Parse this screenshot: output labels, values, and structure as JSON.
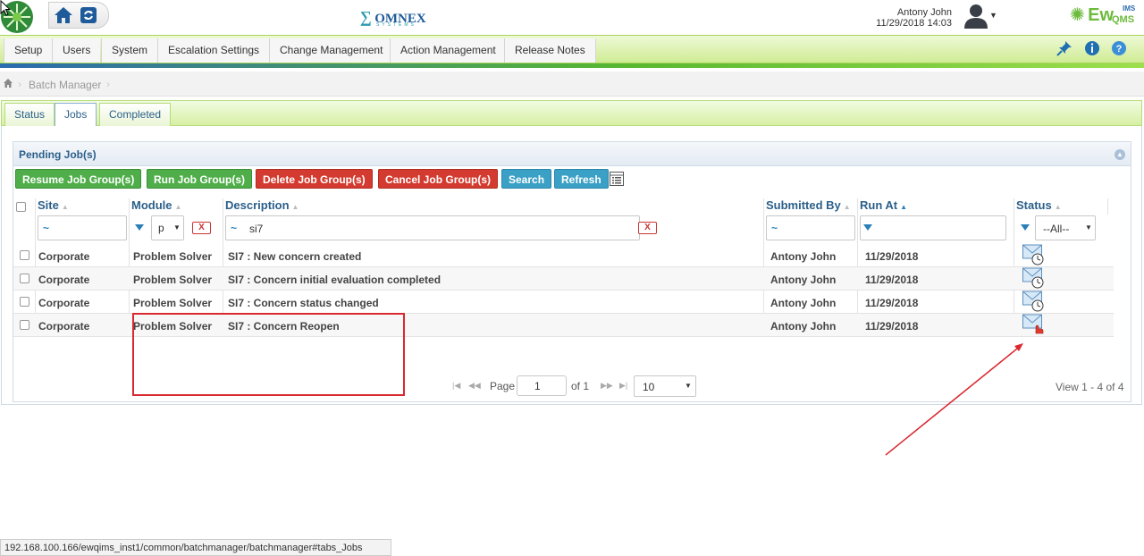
{
  "header": {
    "brand_center": "OMNEX",
    "brand_center_sub": "SYSTEMS",
    "user_name": "Antony John",
    "datetime": "11/29/2018 14:03",
    "brand_right": "Ew",
    "brand_right_sub": "QMS",
    "brand_right_ims": "IMS",
    "brand_color": "#2b6cb0",
    "accent_green": "#58b830"
  },
  "menu": {
    "items": [
      "Setup",
      "Users",
      "System",
      "Escalation Settings",
      "Change Management",
      "Action Management",
      "Release Notes"
    ],
    "icons": [
      "pin-icon",
      "info-icon",
      "help-icon"
    ]
  },
  "breadcrumb": {
    "current": "Batch Manager"
  },
  "tabs": {
    "items": [
      "Status",
      "Jobs",
      "Completed"
    ],
    "active": "Jobs"
  },
  "grid": {
    "title": "Pending Job(s)",
    "buttons": {
      "resume": "Resume Job Group(s)",
      "run": "Run Job Group(s)",
      "delete": "Delete Job Group(s)",
      "cancel": "Cancel Job Group(s)",
      "search": "Search",
      "refresh": "Refresh"
    },
    "columns": {
      "site": "Site",
      "module": "Module",
      "description": "Description",
      "submitted_by": "Submitted By",
      "run_at": "Run At",
      "status": "Status"
    },
    "filters": {
      "site": "~",
      "module": "p",
      "description_tilde": "~",
      "description": "si7",
      "submitted_by": "~",
      "status": "--All--",
      "clear": "X"
    },
    "rows": [
      {
        "site": "Corporate",
        "module": "Problem Solver",
        "description": "SI7 :  New concern created",
        "submitted_by": "Antony John",
        "run_at": "11/29/2018"
      },
      {
        "site": "Corporate",
        "module": "Problem Solver",
        "description": "SI7 :  Concern initial evaluation completed",
        "submitted_by": "Antony John",
        "run_at": "11/29/2018"
      },
      {
        "site": "Corporate",
        "module": "Problem Solver",
        "description": "SI7 :  Concern status changed",
        "submitted_by": "Antony John",
        "run_at": "11/29/2018"
      },
      {
        "site": "Corporate",
        "module": "Problem Solver",
        "description": "SI7 :  Concern Reopen",
        "submitted_by": "Antony John",
        "run_at": "11/29/2018"
      }
    ],
    "pager": {
      "page_label": "Page",
      "page_value": "1",
      "of_label": "of 1",
      "rows_per_page": "10",
      "view_info": "View 1 - 4 of 4"
    }
  },
  "statusbar": {
    "url": "192.168.100.166/ewqims_inst1/common/batchmanager/batchmanager#tabs_Jobs"
  }
}
